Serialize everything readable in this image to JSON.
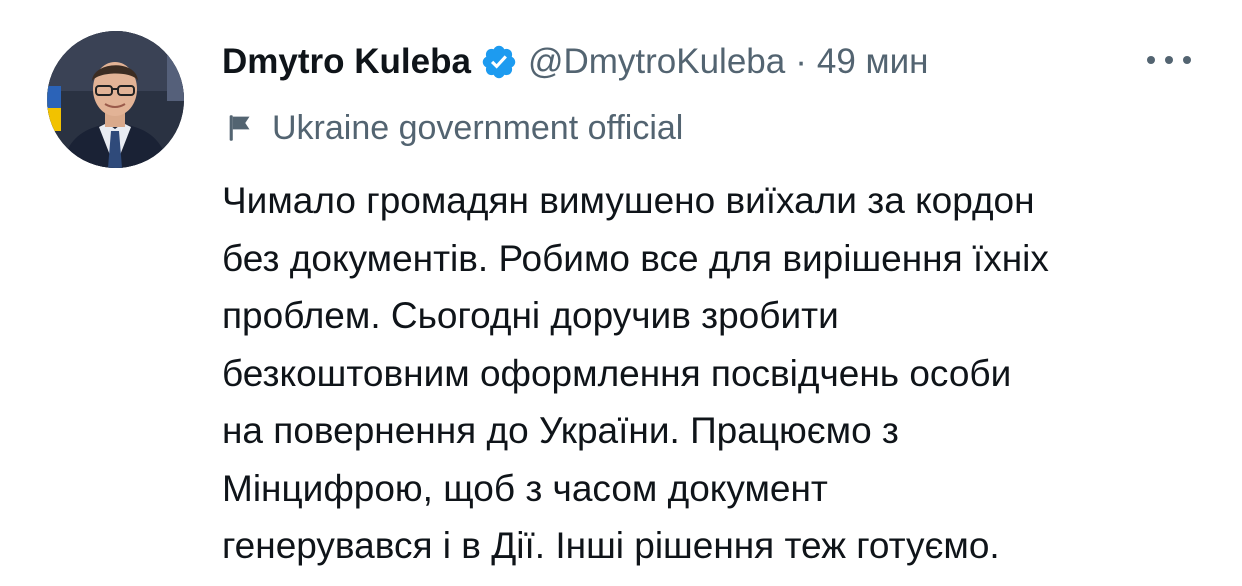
{
  "author": {
    "display_name": "Dmytro Kuleba",
    "handle": "@DmytroKuleba",
    "verified": true
  },
  "meta": {
    "separator": "·",
    "time": "49 мин"
  },
  "label": {
    "icon": "flag-icon",
    "text": "Ukraine government official"
  },
  "tweet": {
    "lines": [
      "Чимало громадян вимушено виїхали за кордон",
      "без документів. Робимо все для вирішення їхніх",
      "проблем. Сьогодні доручив зробити",
      "безкоштовним оформлення посвідчень особи",
      "на повернення до України. Працюємо з",
      "Мінцифрою, щоб з часом документ",
      "генерувався і в Дії. Інші рішення теж готуємо."
    ]
  },
  "colors": {
    "text_primary": "#0f1419",
    "text_secondary": "#536471",
    "verified_blue": "#1d9bf0"
  }
}
